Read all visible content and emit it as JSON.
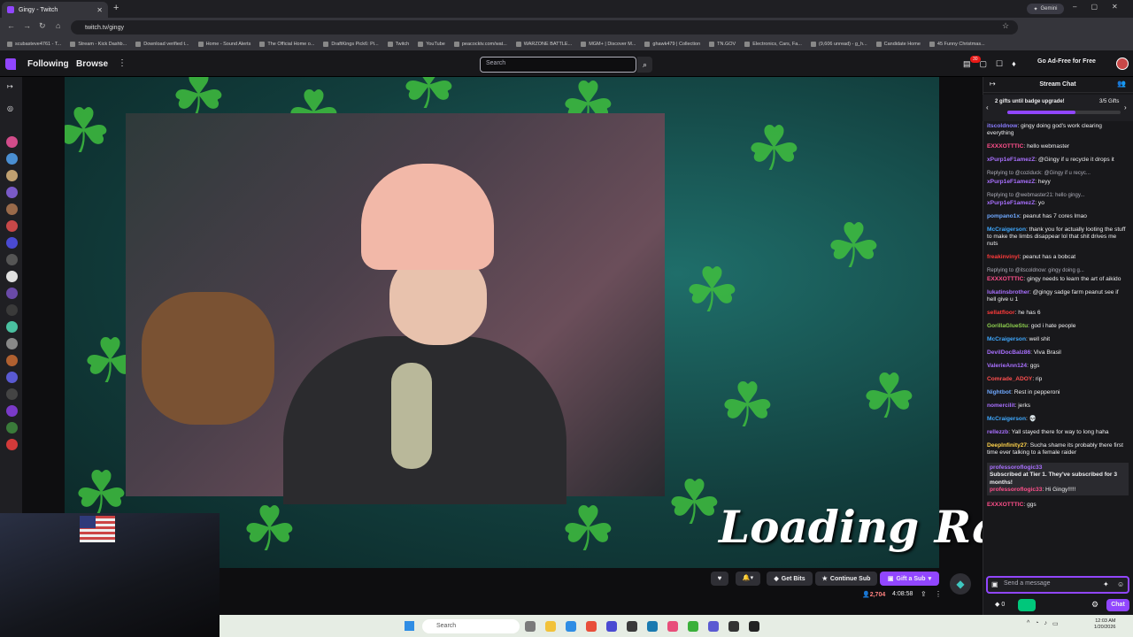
{
  "browser": {
    "tab_title": "Gingy - Twitch",
    "url": "twitch.tv/gingy",
    "gemini_label": "Gemini",
    "bookmarks": [
      "scubasteve4761 - T...",
      "Stream - Kick Dashb...",
      "Download verified t...",
      "Home - Sound Alerts",
      "The Official Home o...",
      "DraftKings Pick6: Pi...",
      "Twitch",
      "YouTube",
      "peacocktv.com/wat...",
      "WARZONE BATTLE...",
      "MGM+ | Discover M...",
      "ghawk479 | Collection",
      "TN.GOV",
      "Electronics, Cars, Fa...",
      "(9,606 unread) - g_h...",
      "Candidate Home",
      "45 Funny Christmas..."
    ]
  },
  "twitch_nav": {
    "following": "Following",
    "browse": "Browse",
    "search_placeholder": "Search",
    "notification_count": "30",
    "ad_free": "Go Ad-Free for Free"
  },
  "stream": {
    "overlay_text": "Loading Raid",
    "viewers": "2,704",
    "uptime": "4:08:58",
    "buttons": {
      "get_bits": "Get Bits",
      "continue_sub": "Continue Sub",
      "gift_sub": "Gift a Sub"
    }
  },
  "chat": {
    "header": "Stream Chat",
    "badge_title": "2 gifts until badge upgrade!",
    "badge_count": "3/5 Gifts",
    "badge_progress": 0.6,
    "input_placeholder": "Send a message",
    "bits": "0",
    "send_label": "Chat",
    "messages": [
      {
        "user": "itscoldnow",
        "color": "#8a7cff",
        "text": "gingy doing god's work clearing everything"
      },
      {
        "user": "EXXXOTTTIC",
        "color": "#ff4f8b",
        "text": "hello webmaster"
      },
      {
        "user": "xPurp1eF1amezZ",
        "color": "#a970ff",
        "text": "@Gingy if u recycle it drops it"
      },
      {
        "reply": "Replying to @coziduck: @Gingy if u recyc...",
        "user": "xPurp1eF1amezZ",
        "color": "#a970ff",
        "text": "heyy"
      },
      {
        "reply": "Replying to @webmaster21: hello gingy...",
        "user": "xPurp1eF1amezZ",
        "color": "#a970ff",
        "text": "yo"
      },
      {
        "user": "pompano1x",
        "color": "#6fa8ff",
        "text": "peanut has 7 cores lmao"
      },
      {
        "user": "McCraigerson",
        "color": "#3fa9ff",
        "text": "thank you for actually looting the stuff to make the limbs disappear lol that shit drives me nuts"
      },
      {
        "user": "freakinvinyl",
        "color": "#ff3b3b",
        "text": "peanut has a bobcat"
      },
      {
        "reply": "Replying to @itscoldnow: gingy doing g...",
        "user": "EXXXOTTTIC",
        "color": "#ff4f8b",
        "text": "gingy needs to learn the art of aikido"
      },
      {
        "user": "lukatinsbrother",
        "color": "#a970ff",
        "text": "@gingy sadge farm peanut see if hell give u 1"
      },
      {
        "user": "sellatfloor",
        "color": "#ff3b3b",
        "text": "he has 6"
      },
      {
        "user": "GorillaGlueStu",
        "color": "#8fd14f",
        "text": "god i hate people"
      },
      {
        "user": "McCraigerson",
        "color": "#3fa9ff",
        "text": "well shit"
      },
      {
        "user": "DevilDocBalz86",
        "color": "#a970ff",
        "text": "Viva Brasil"
      },
      {
        "user": "ValerieAnn124",
        "color": "#a970ff",
        "text": "ggs"
      },
      {
        "user": "Comrade_ADOY",
        "color": "#ff4f4f",
        "text": "rip"
      },
      {
        "user": "Nightbot",
        "color": "#6fa8ff",
        "text": "Rest in pepperoni"
      },
      {
        "user": "nomercilit",
        "color": "#a970ff",
        "text": "jerks"
      },
      {
        "user": "McCraigerson",
        "color": "#3fa9ff",
        "text": "💀"
      },
      {
        "user": "rellezzb",
        "color": "#a970ff",
        "text": "Yall stayed there for way to long haha"
      },
      {
        "user": "DeepInfinity27",
        "color": "#ffd24a",
        "text": "Sucha shame its probably there first time ever talking to a female raider"
      }
    ],
    "sub_alert": {
      "user": "professoroflogic33",
      "line1": "Subscribed at Tier 1. They've subscribed for",
      "months": "3 months!",
      "reply_user": "professoroflogic33",
      "reply_text": "Hi Gingy!!!!!"
    },
    "last_message": {
      "user": "EXXXOTTTIC",
      "color": "#ff4f8b",
      "text": "ggs"
    }
  },
  "taskbar": {
    "search": "Search",
    "time": "12:03 AM",
    "date": "1/20/2026"
  }
}
